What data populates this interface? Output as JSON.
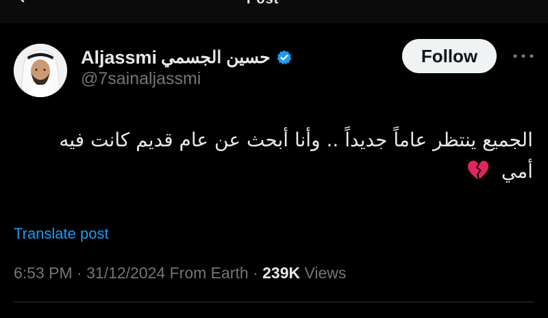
{
  "header": {
    "title": "Post"
  },
  "author": {
    "name_latin": "Aljassmi",
    "name_arabic": "حسين الجسمي",
    "handle": "@7sainaljassmi",
    "verified_color": "#1d9bf0"
  },
  "follow_label": "Follow",
  "tweet": {
    "line1": "الجميع ينتظر عاماً جديداً .. وأنا أبحث عن عام قديم كانت فيه",
    "line2": "أمي",
    "emoji": "broken-heart-icon"
  },
  "translate_label": "Translate post",
  "meta": {
    "time": "6:53 PM",
    "sep1": "·",
    "date": "31/12/2024",
    "source": "From Earth",
    "sep2": "·",
    "views_count": "239K",
    "views_label": "Views"
  },
  "colors": {
    "background": "#000000",
    "link": "#1d9bf0",
    "muted": "#71767b",
    "text": "#e7e9ea"
  }
}
